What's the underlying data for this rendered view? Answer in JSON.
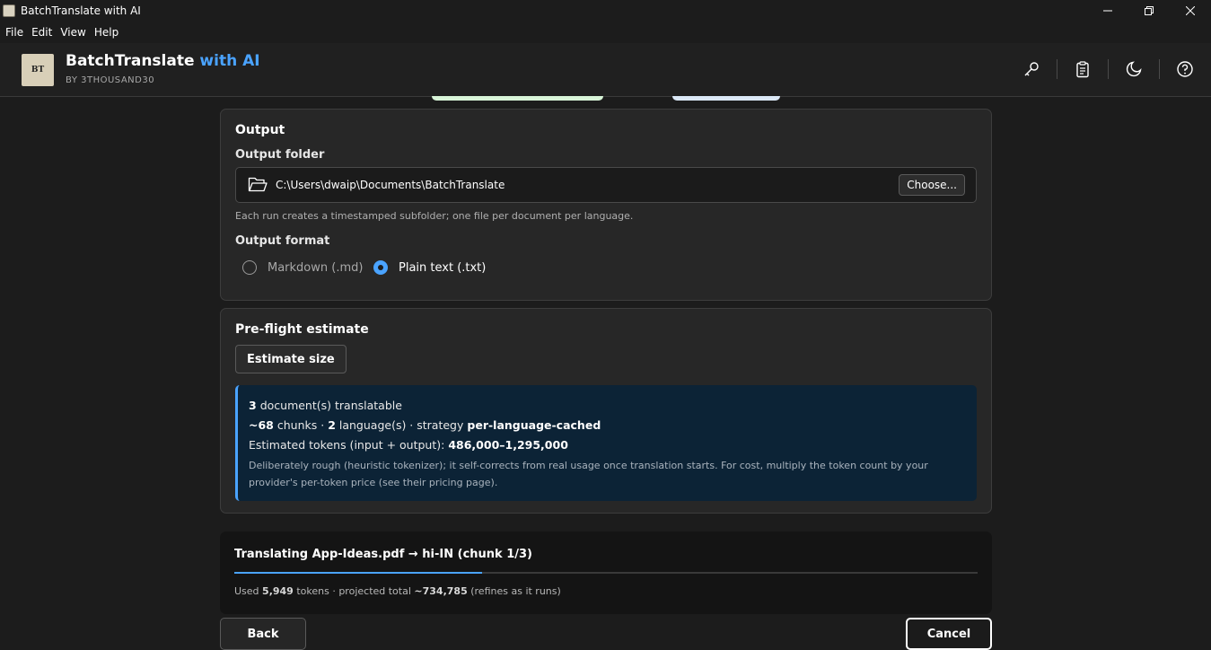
{
  "window": {
    "title": "BatchTranslate with AI"
  },
  "menu": [
    "File",
    "Edit",
    "View",
    "Help"
  ],
  "header": {
    "brand": "BatchTranslate",
    "brand_accent": "with AI",
    "byline": "BY 3THOUSAND30",
    "logo_text": "BT",
    "icons": [
      "key-icon",
      "clipboard-icon",
      "moon-icon",
      "help-icon"
    ]
  },
  "output": {
    "title": "Output",
    "folder_label": "Output folder",
    "folder_path": "C:\\Users\\dwaip\\Documents\\BatchTranslate",
    "choose_label": "Choose...",
    "folder_hint": "Each run creates a timestamped subfolder; one file per document per language.",
    "format_label": "Output format",
    "formats": [
      {
        "label": "Markdown (.md)",
        "selected": false
      },
      {
        "label": "Plain text (.txt)",
        "selected": true
      }
    ]
  },
  "estimate": {
    "title": "Pre-flight estimate",
    "button_label": "Estimate size",
    "doc_count": "3",
    "doc_text": "document(s) translatable",
    "chunks": "~68",
    "chunks_text": "chunks ·",
    "languages": "2",
    "languages_text": "language(s) · strategy",
    "strategy": "per-language-cached",
    "tokens_label": "Estimated tokens (input + output):",
    "tokens_range": "486,000–1,295,000",
    "note": "Deliberately rough (heuristic tokenizer); it self-corrects from real usage once translation starts. For cost, multiply the token count by your provider's per-token price (see their pricing page)."
  },
  "progress": {
    "title": "Translating App-Ideas.pdf → hi-IN (chunk 1/3)",
    "fraction": 0.333,
    "used_prefix": "Used",
    "used_tokens": "5,949",
    "used_mid": "tokens · projected total",
    "projected": "~734,785",
    "used_suffix": "(refines as it runs)"
  },
  "footer": {
    "back_label": "Back",
    "cancel_label": "Cancel"
  },
  "colors": {
    "accent": "#4aa3ff",
    "info_bg": "#0c2336"
  }
}
